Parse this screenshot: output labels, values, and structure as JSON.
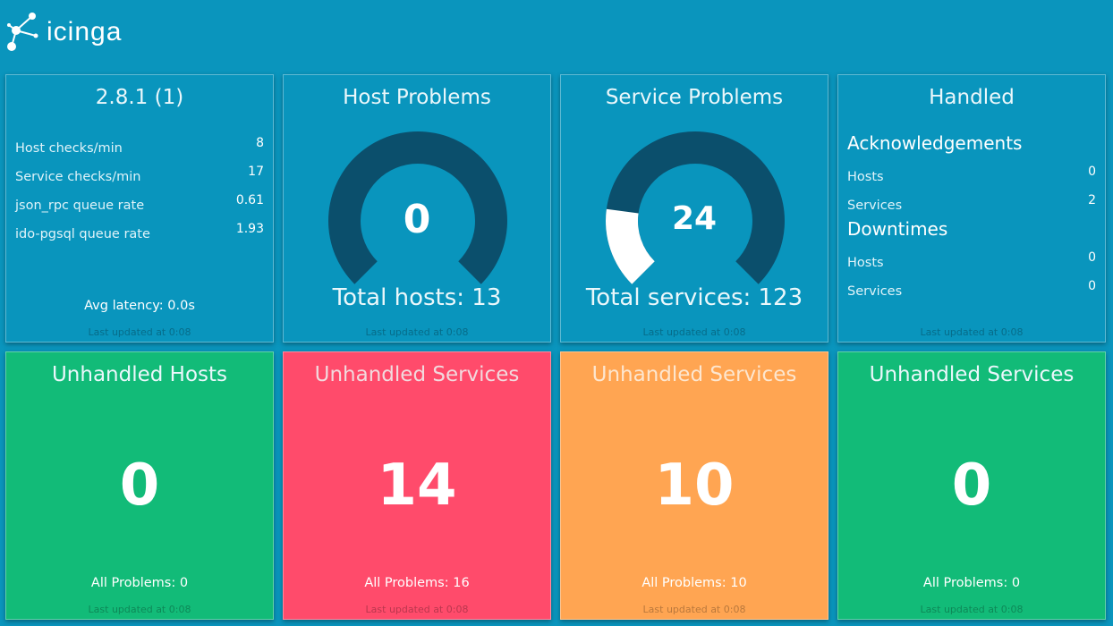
{
  "header": {
    "logo_text": "icinga"
  },
  "colors": {
    "background": "#0a95bd",
    "blue": "#0995bd",
    "green": "#12bb78",
    "red": "#ff4b6b",
    "orange": "#ffa552",
    "gauge_track": "#0b4f6c",
    "gauge_fill": "#ffffff"
  },
  "status": {
    "title": "2.8.1 (1)",
    "rows": [
      {
        "label": "Host checks/min",
        "value": "8"
      },
      {
        "label": "Service checks/min",
        "value": "17"
      },
      {
        "label": "json_rpc queue rate",
        "value": "0.61"
      },
      {
        "label": "ido-pgsql queue rate",
        "value": "1.93"
      }
    ],
    "avg_latency": "Avg latency: 0.0s",
    "updated": "Last updated at 0:08"
  },
  "host_problems": {
    "title": "Host Problems",
    "value": "0",
    "fraction": 0,
    "total": "Total hosts: 13",
    "updated": "Last updated at 0:08"
  },
  "service_problems": {
    "title": "Service Problems",
    "value": "24",
    "fraction": 0.195,
    "total": "Total services: 123",
    "updated": "Last updated at 0:08"
  },
  "handled": {
    "title": "Handled",
    "ack_heading": "Acknowledgements",
    "ack_rows": [
      {
        "label": "Hosts",
        "value": "0"
      },
      {
        "label": "Services",
        "value": "2"
      }
    ],
    "down_heading": "Downtimes",
    "down_rows": [
      {
        "label": "Hosts",
        "value": "0"
      },
      {
        "label": "Services",
        "value": "0"
      }
    ],
    "updated": "Last updated at 0:08"
  },
  "tiles": [
    {
      "title": "Unhandled Hosts",
      "value": "0",
      "all": "All Problems: 0",
      "updated": "Last updated at 0:08"
    },
    {
      "title": "Unhandled Services",
      "value": "14",
      "all": "All Problems: 16",
      "updated": "Last updated at 0:08"
    },
    {
      "title": "Unhandled Services",
      "value": "10",
      "all": "All Problems: 10",
      "updated": "Last updated at 0:08"
    },
    {
      "title": "Unhandled Services",
      "value": "0",
      "all": "All Problems: 0",
      "updated": "Last updated at 0:08"
    }
  ]
}
